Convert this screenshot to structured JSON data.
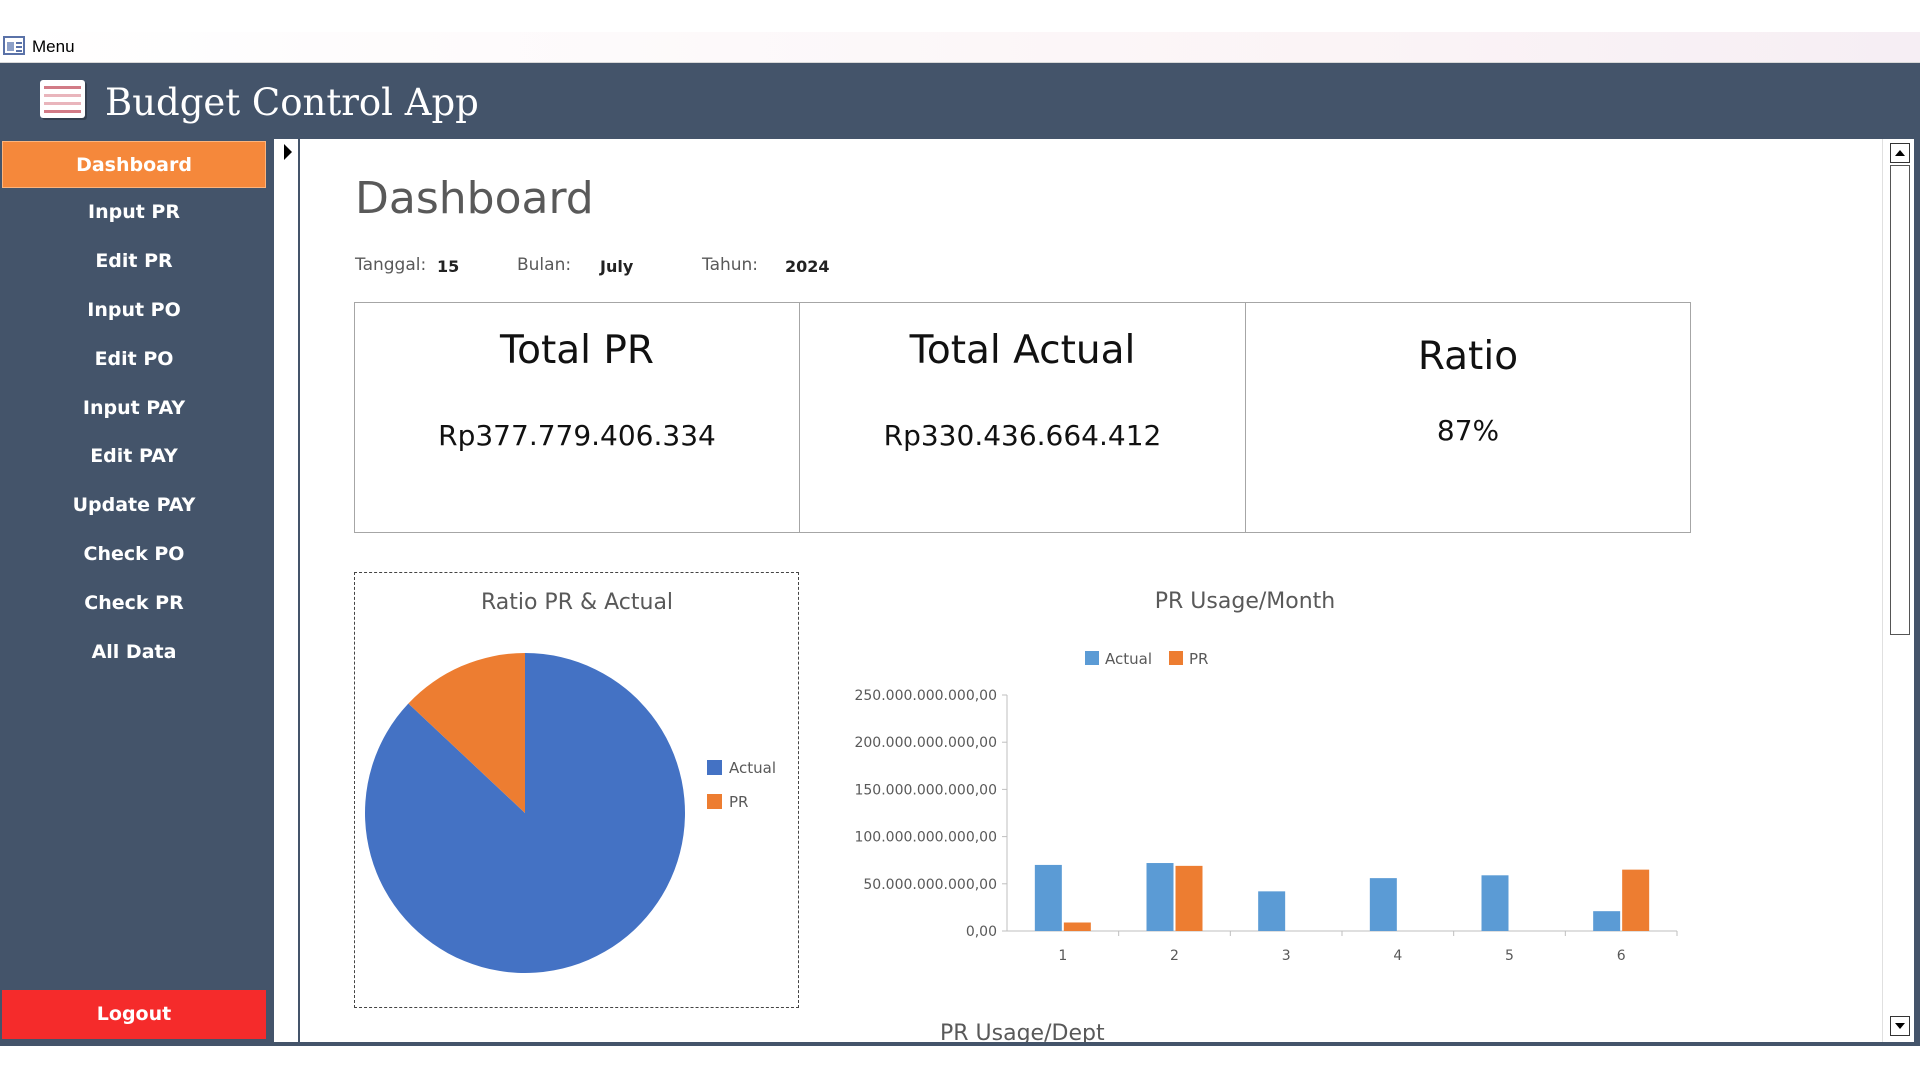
{
  "window": {
    "title": "Menu"
  },
  "header": {
    "app_title": "Budget Control App"
  },
  "sidebar": {
    "items": [
      {
        "label": "Dashboard",
        "active": true
      },
      {
        "label": "Input PR"
      },
      {
        "label": "Edit PR"
      },
      {
        "label": "Input PO"
      },
      {
        "label": "Edit PO"
      },
      {
        "label": "Input PAY"
      },
      {
        "label": "Edit PAY"
      },
      {
        "label": "Update PAY"
      },
      {
        "label": "Check PO"
      },
      {
        "label": "Check PR"
      },
      {
        "label": "All Data"
      }
    ],
    "logout_label": "Logout",
    "active_color": "#f5883b",
    "logout_color": "#f52b2b",
    "background_color": "#44546a"
  },
  "dashboard": {
    "title": "Dashboard",
    "date": {
      "tanggal_label": "Tanggal:",
      "tanggal_value": "15",
      "bulan_label": "Bulan:",
      "bulan_value": "July",
      "tahun_label": "Tahun:",
      "tahun_value": "2024"
    },
    "kpis": [
      {
        "title": "Total PR",
        "value": "Rp377.779.406.334"
      },
      {
        "title": "Total Actual",
        "value": "Rp330.436.664.412"
      },
      {
        "title": "Ratio",
        "value": "87%"
      }
    ],
    "next_section_title": "PR Usage/Dept"
  },
  "chart_data": [
    {
      "type": "pie",
      "title": "Ratio PR & Actual",
      "labels": [
        "Actual",
        "PR"
      ],
      "values": [
        87,
        13
      ],
      "colors": [
        "#4472c4",
        "#ed7d31"
      ],
      "legend": "right"
    },
    {
      "type": "bar",
      "title": "PR Usage/Month",
      "categories": [
        "1",
        "2",
        "3",
        "4",
        "5",
        "6"
      ],
      "series": [
        {
          "name": "Actual",
          "color": "#5b9bd5",
          "values": [
            70000000000,
            72000000000,
            42000000000,
            56000000000,
            59000000000,
            21000000000
          ]
        },
        {
          "name": "PR",
          "color": "#ed7d31",
          "values": [
            9000000000,
            69000000000,
            0,
            0,
            0,
            65000000000
          ]
        }
      ],
      "ylim": [
        0,
        250000000000
      ],
      "yticks": [
        "0,00",
        "50.000.000.000,00",
        "100.000.000.000,00",
        "150.000.000.000,00",
        "200.000.000.000,00",
        "250.000.000.000,00"
      ],
      "legend": "top",
      "grid": false
    }
  ]
}
